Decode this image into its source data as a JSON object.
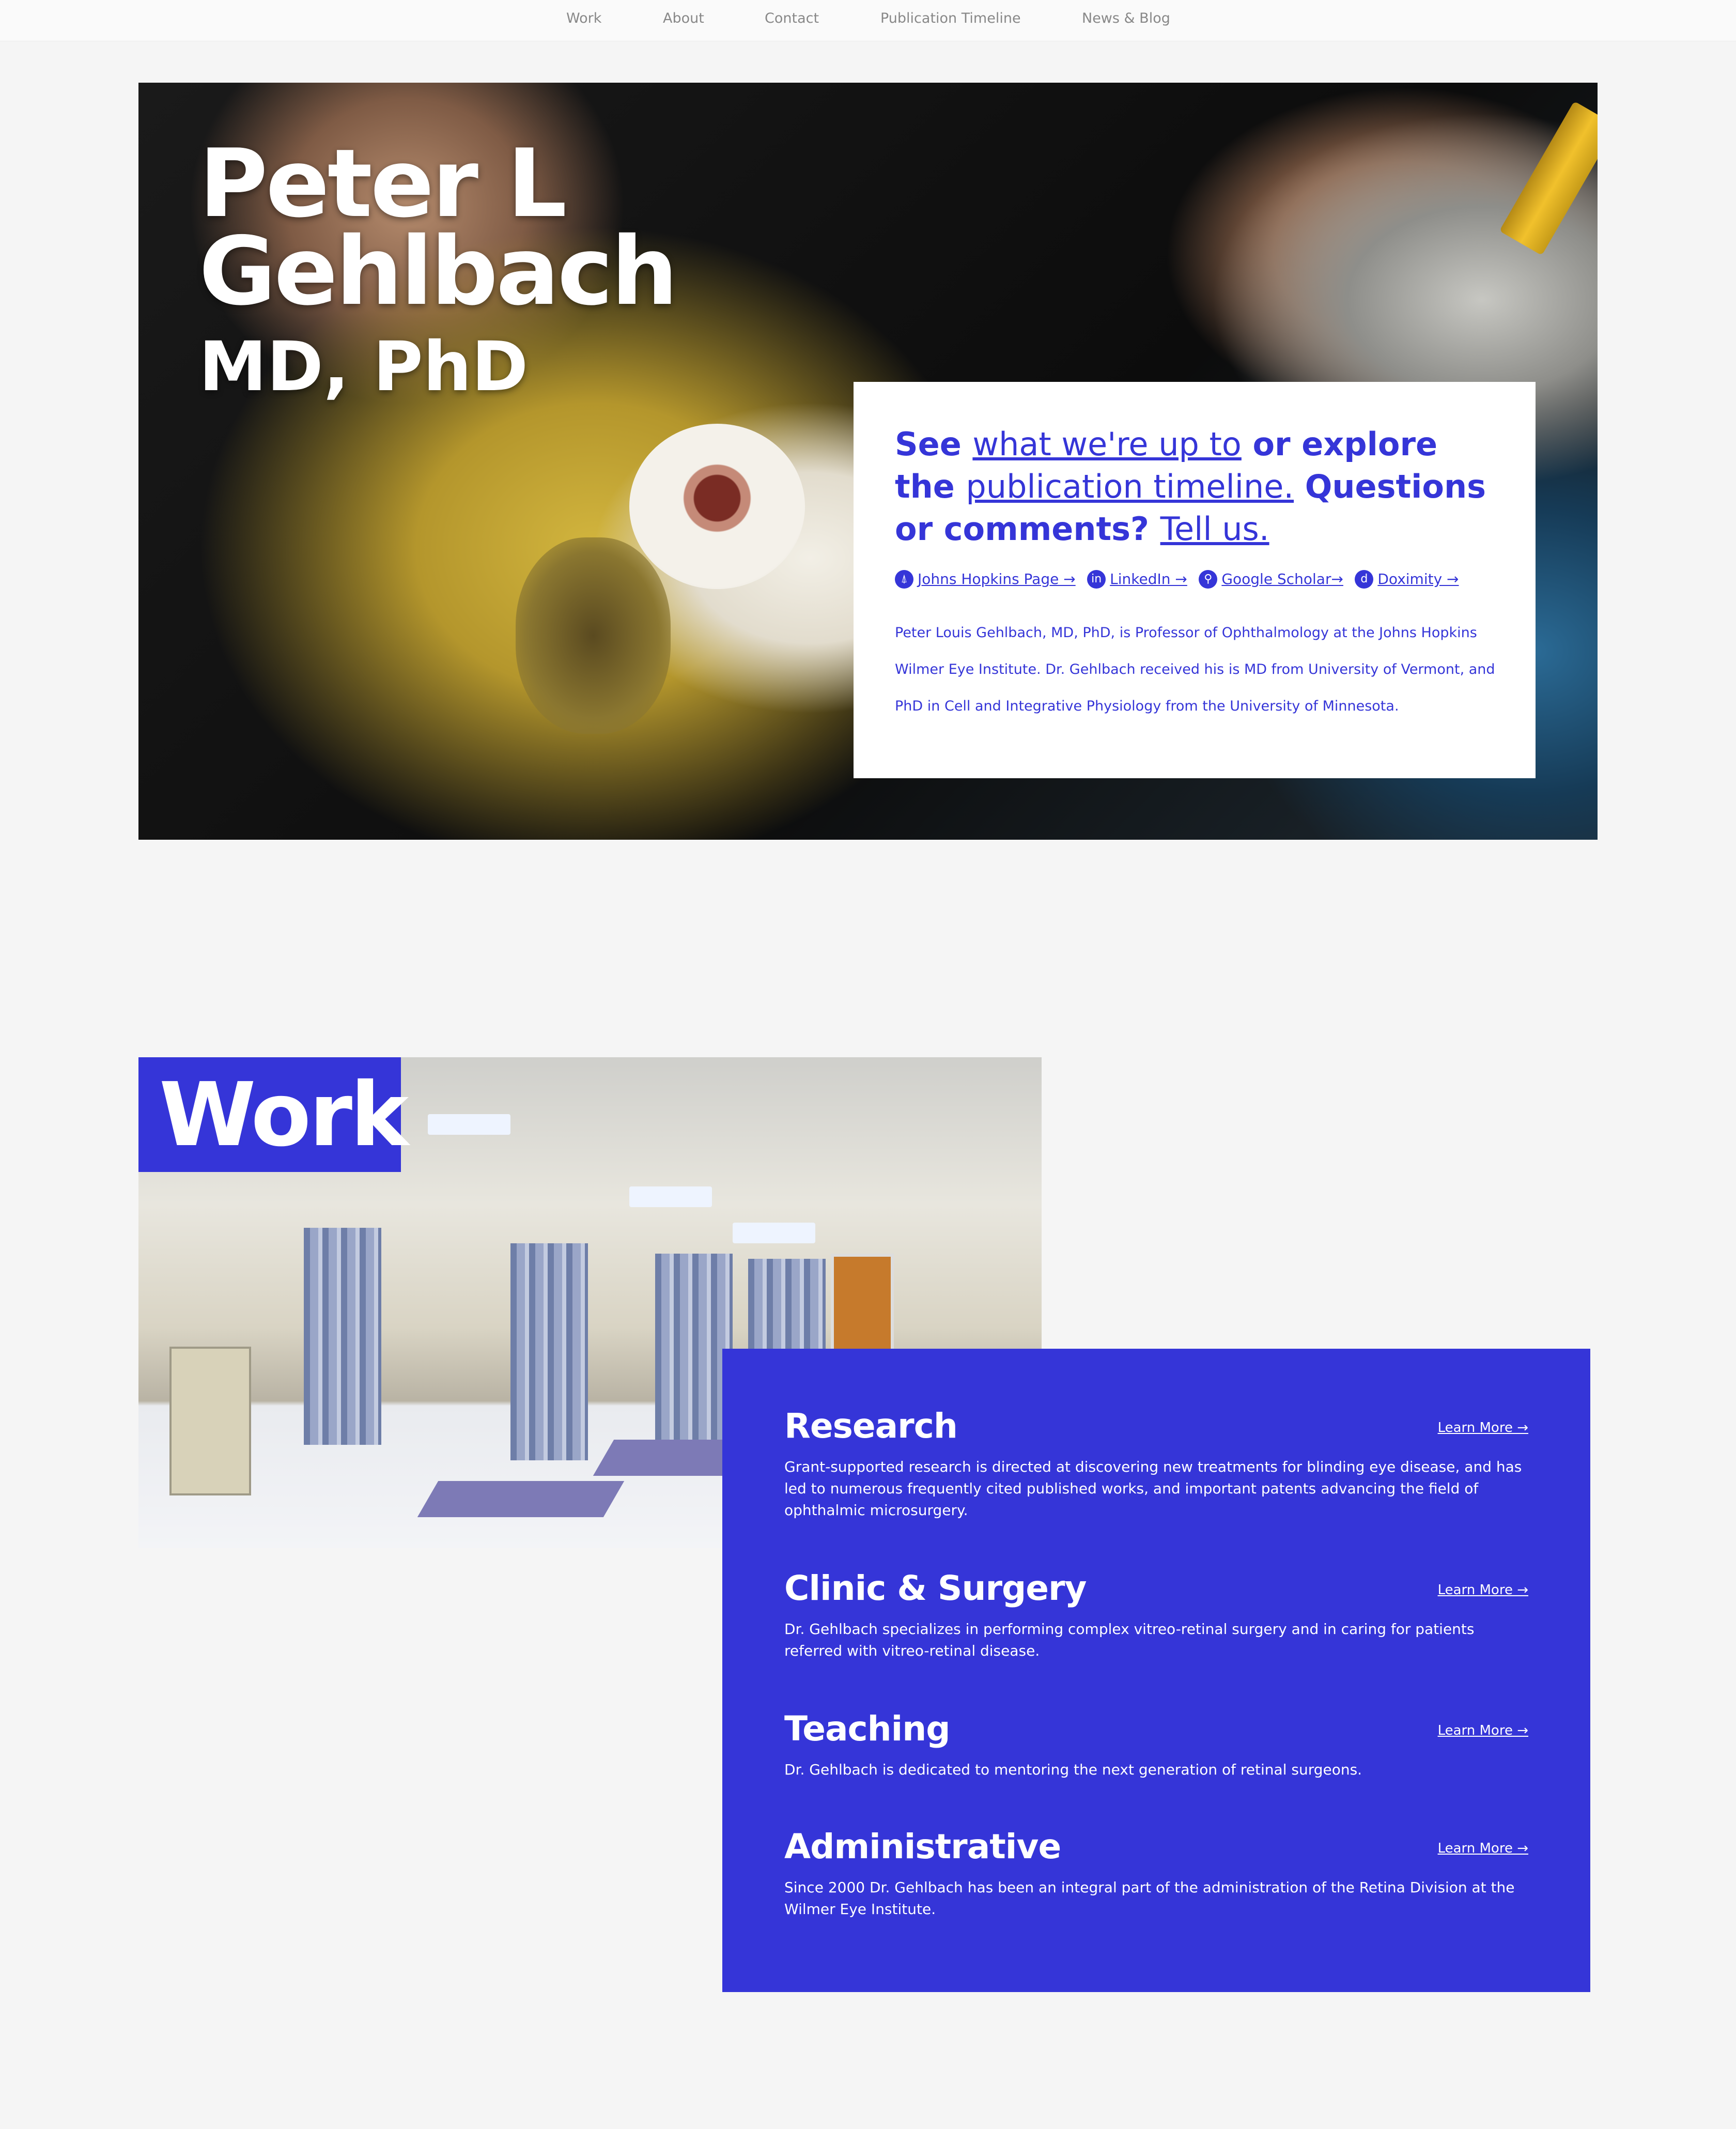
{
  "nav": {
    "items": [
      "Work",
      "About",
      "Contact",
      "Publication Timeline",
      "News & Blog"
    ]
  },
  "hero": {
    "name_line1": "Peter L",
    "name_line2": "Gehlbach",
    "credentials": "MD, PhD"
  },
  "intro": {
    "see": "See",
    "link_up_to": "what we're up to",
    "or_explore": "or explore the",
    "link_timeline": "publication timeline.",
    "questions": "Questions or comments?",
    "link_tell": "Tell us.",
    "profiles": [
      {
        "icon": "jhu-icon",
        "glyph": "⍋",
        "label": "Johns Hopkins Page →"
      },
      {
        "icon": "linkedin-icon",
        "glyph": "in",
        "label": "LinkedIn →"
      },
      {
        "icon": "google-scholar-icon",
        "glyph": "⚲",
        "label": "Google Scholar→"
      },
      {
        "icon": "doximity-icon",
        "glyph": "d",
        "label": "Doximity →"
      }
    ],
    "bio": "Peter Louis Gehlbach, MD, PhD, is Professor of Ophthalmology at the Johns Hopkins Wilmer Eye Institute. Dr. Gehlbach received his is MD from University of Vermont, and PhD in Cell and Integrative Physiology from the University of Minnesota."
  },
  "work": {
    "title": "Work",
    "items": [
      {
        "heading": "Research",
        "more": "Learn More →",
        "text": "Grant-supported research is directed at discovering new treatments for blinding eye disease, and has led to numerous frequently cited published works, and important patents advancing the field of ophthalmic microsurgery."
      },
      {
        "heading": "Clinic & Surgery",
        "more": "Learn More →",
        "text": "Dr. Gehlbach specializes in performing complex vitreo-retinal surgery and in caring for patients referred with vitreo-retinal disease."
      },
      {
        "heading": "Teaching",
        "more": "Learn More →",
        "text": "Dr. Gehlbach is dedicated to mentoring the next generation of retinal surgeons."
      },
      {
        "heading": "Administrative",
        "more": "Learn More →",
        "text": "Since 2000 Dr. Gehlbach has been an integral part of the administration of the Retina Division at the Wilmer Eye Institute."
      }
    ]
  },
  "colors": {
    "accent": "#3535d8",
    "background": "#f5f5f5",
    "nav_text": "#888888"
  }
}
